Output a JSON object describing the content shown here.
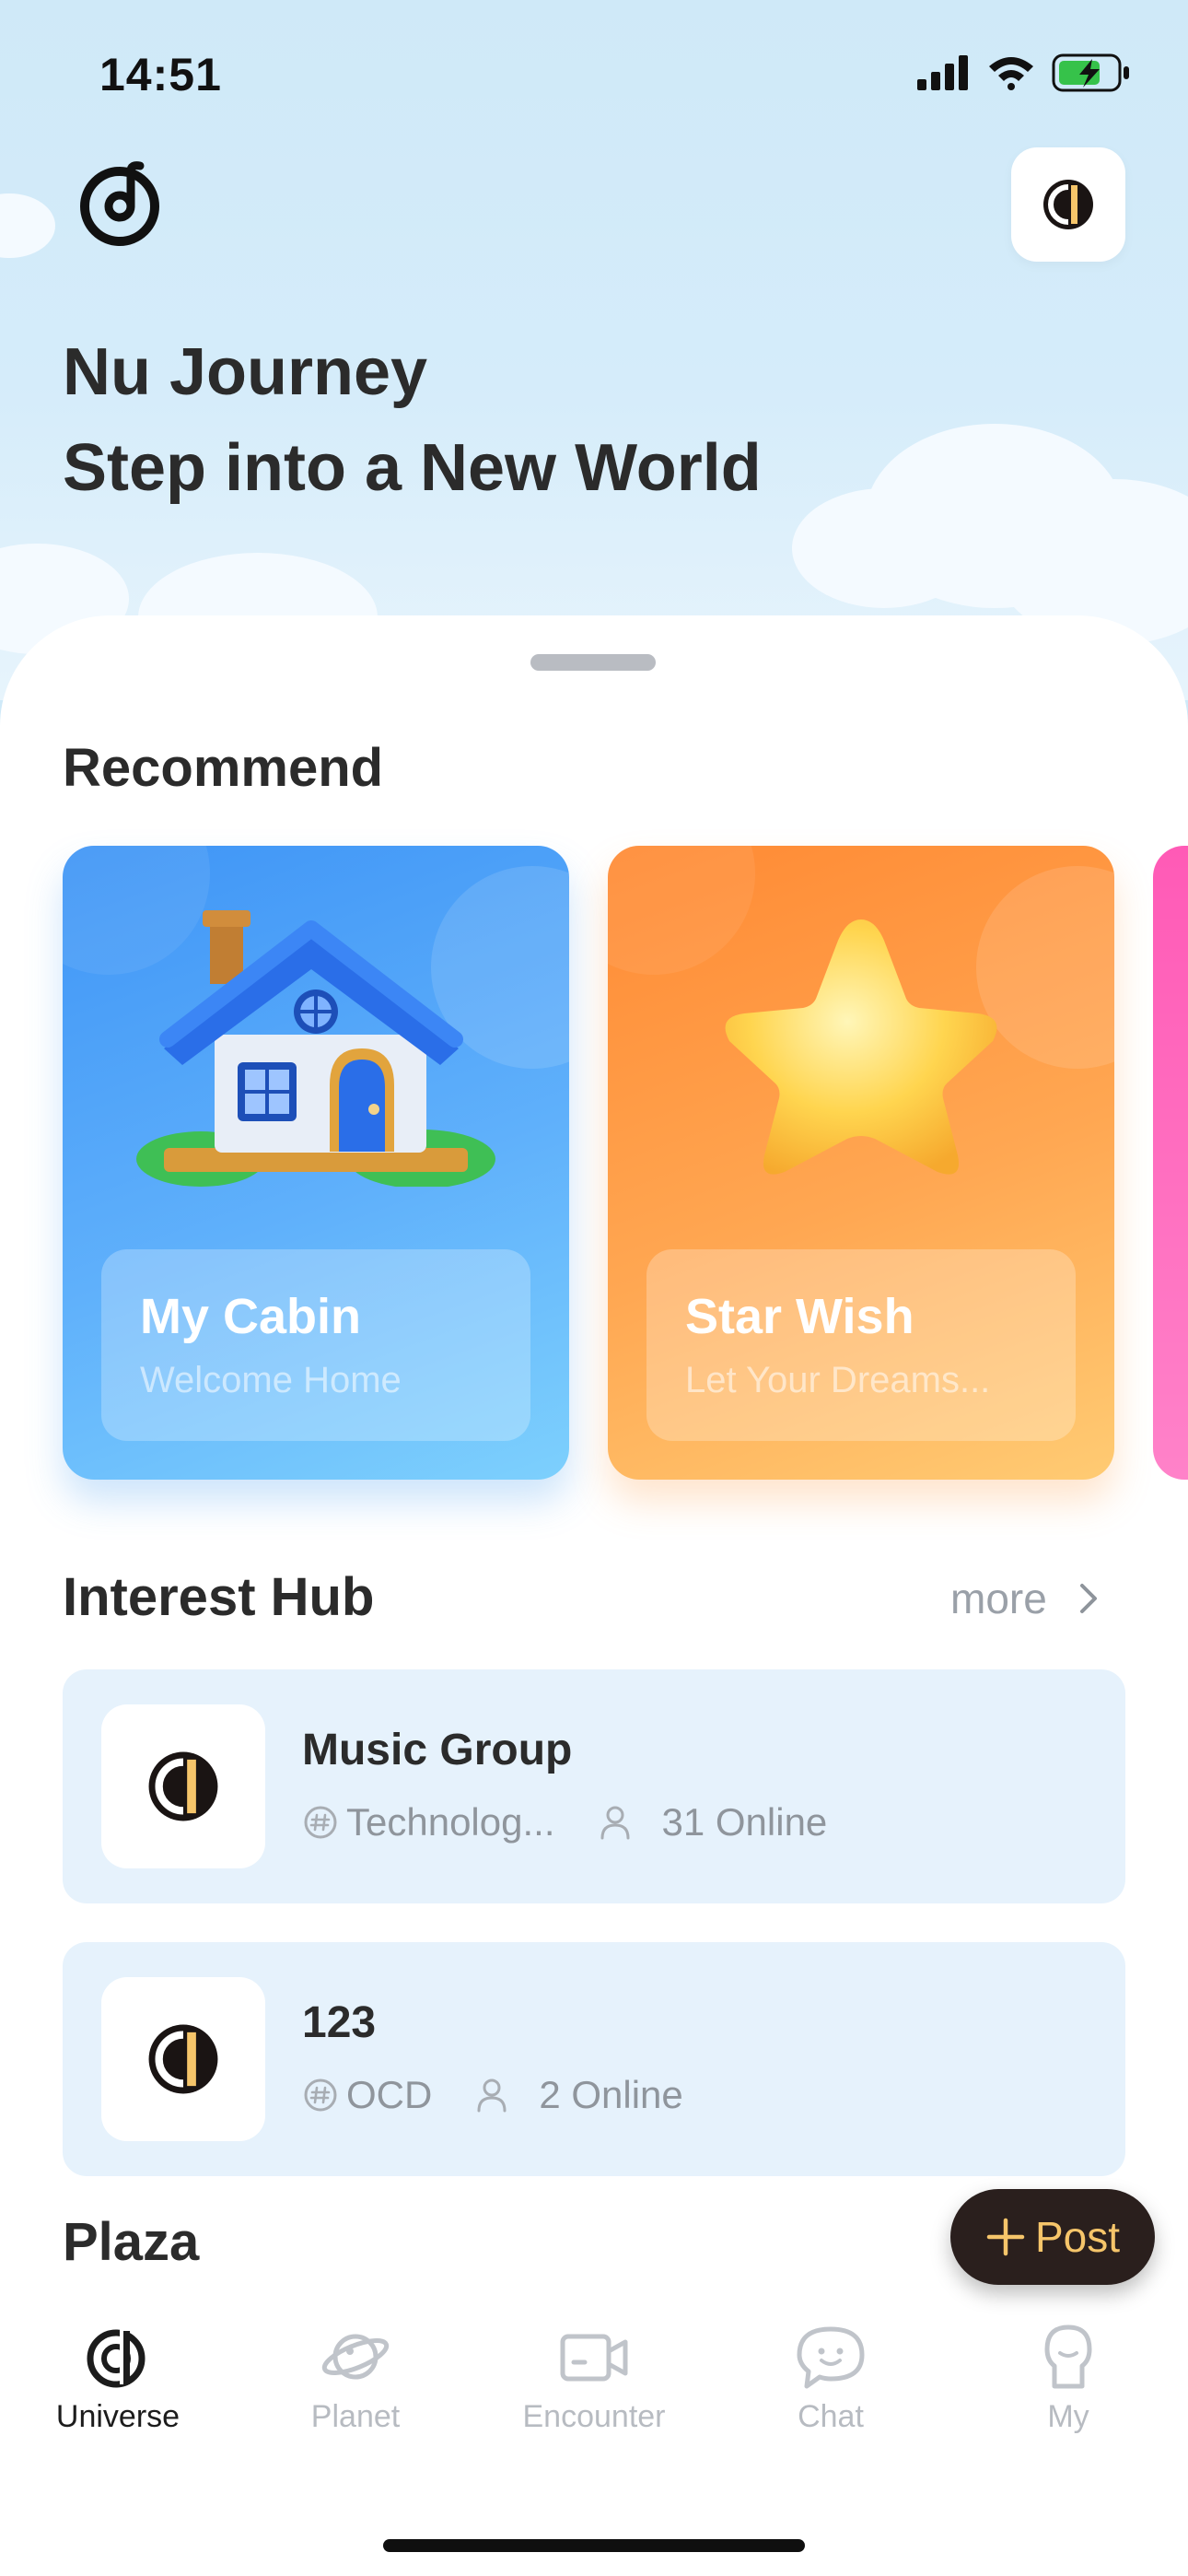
{
  "status_bar": {
    "time": "14:51"
  },
  "hero": {
    "line1": "Nu Journey",
    "line2": "Step into a New World"
  },
  "recommend": {
    "title": "Recommend",
    "cards": [
      {
        "title": "My Cabin",
        "subtitle": "Welcome Home"
      },
      {
        "title": "Star Wish",
        "subtitle": "Let Your Dreams..."
      }
    ]
  },
  "interest_hub": {
    "title": "Interest Hub",
    "more_label": "more",
    "items": [
      {
        "name": "Music Group",
        "tag": "Technolog...",
        "online": "31 Online"
      },
      {
        "name": "123",
        "tag": "OCD",
        "online": "2 Online"
      }
    ]
  },
  "plaza": {
    "title": "Plaza"
  },
  "post_button": {
    "label": "Post"
  },
  "tabs": [
    {
      "label": "Universe",
      "icon": "universe-icon",
      "active": true
    },
    {
      "label": "Planet",
      "icon": "planet-icon",
      "active": false
    },
    {
      "label": "Encounter",
      "icon": "encounter-icon",
      "active": false
    },
    {
      "label": "Chat",
      "icon": "chat-icon",
      "active": false
    },
    {
      "label": "My",
      "icon": "profile-icon",
      "active": false
    }
  ],
  "colors": {
    "sky": "#cfe9f8",
    "card_blue": "#4a9ef7",
    "card_orange": "#ff9a44",
    "hub_bg": "#e6f2fc",
    "post_button_bg": "#2a1f1d",
    "post_button_text": "#f6c56a"
  }
}
